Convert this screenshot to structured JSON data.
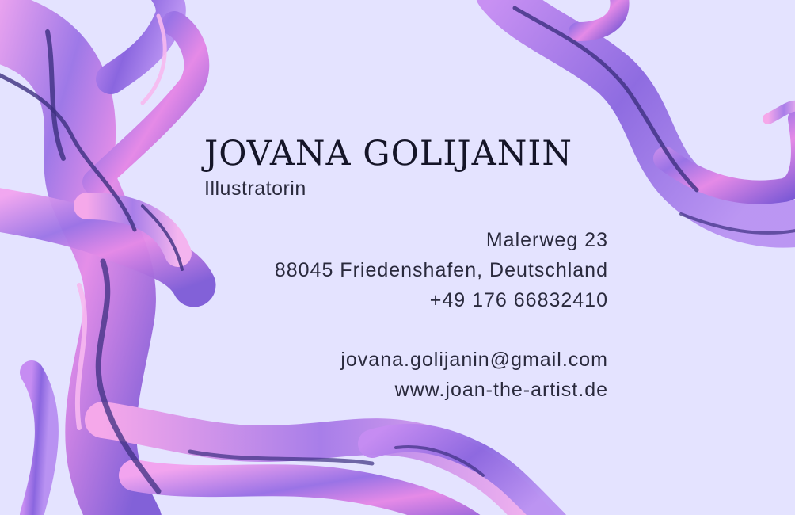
{
  "card": {
    "name": "JOVANA GOLIJANIN",
    "title": "Illustratorin",
    "address": {
      "street": "Malerweg 23",
      "city_line": "88045 Friedenshafen, Deutschland"
    },
    "phone": "+49 176 66832410",
    "email": "jovana.golijanin@gmail.com",
    "website": "www.joan-the-artist.de"
  },
  "colors": {
    "background": "#e4e3ff",
    "text": "#2a2a3d",
    "swirl_purple": "#7e5cd6",
    "swirl_pink": "#f08ee8",
    "swirl_dark": "#3c2f80"
  }
}
